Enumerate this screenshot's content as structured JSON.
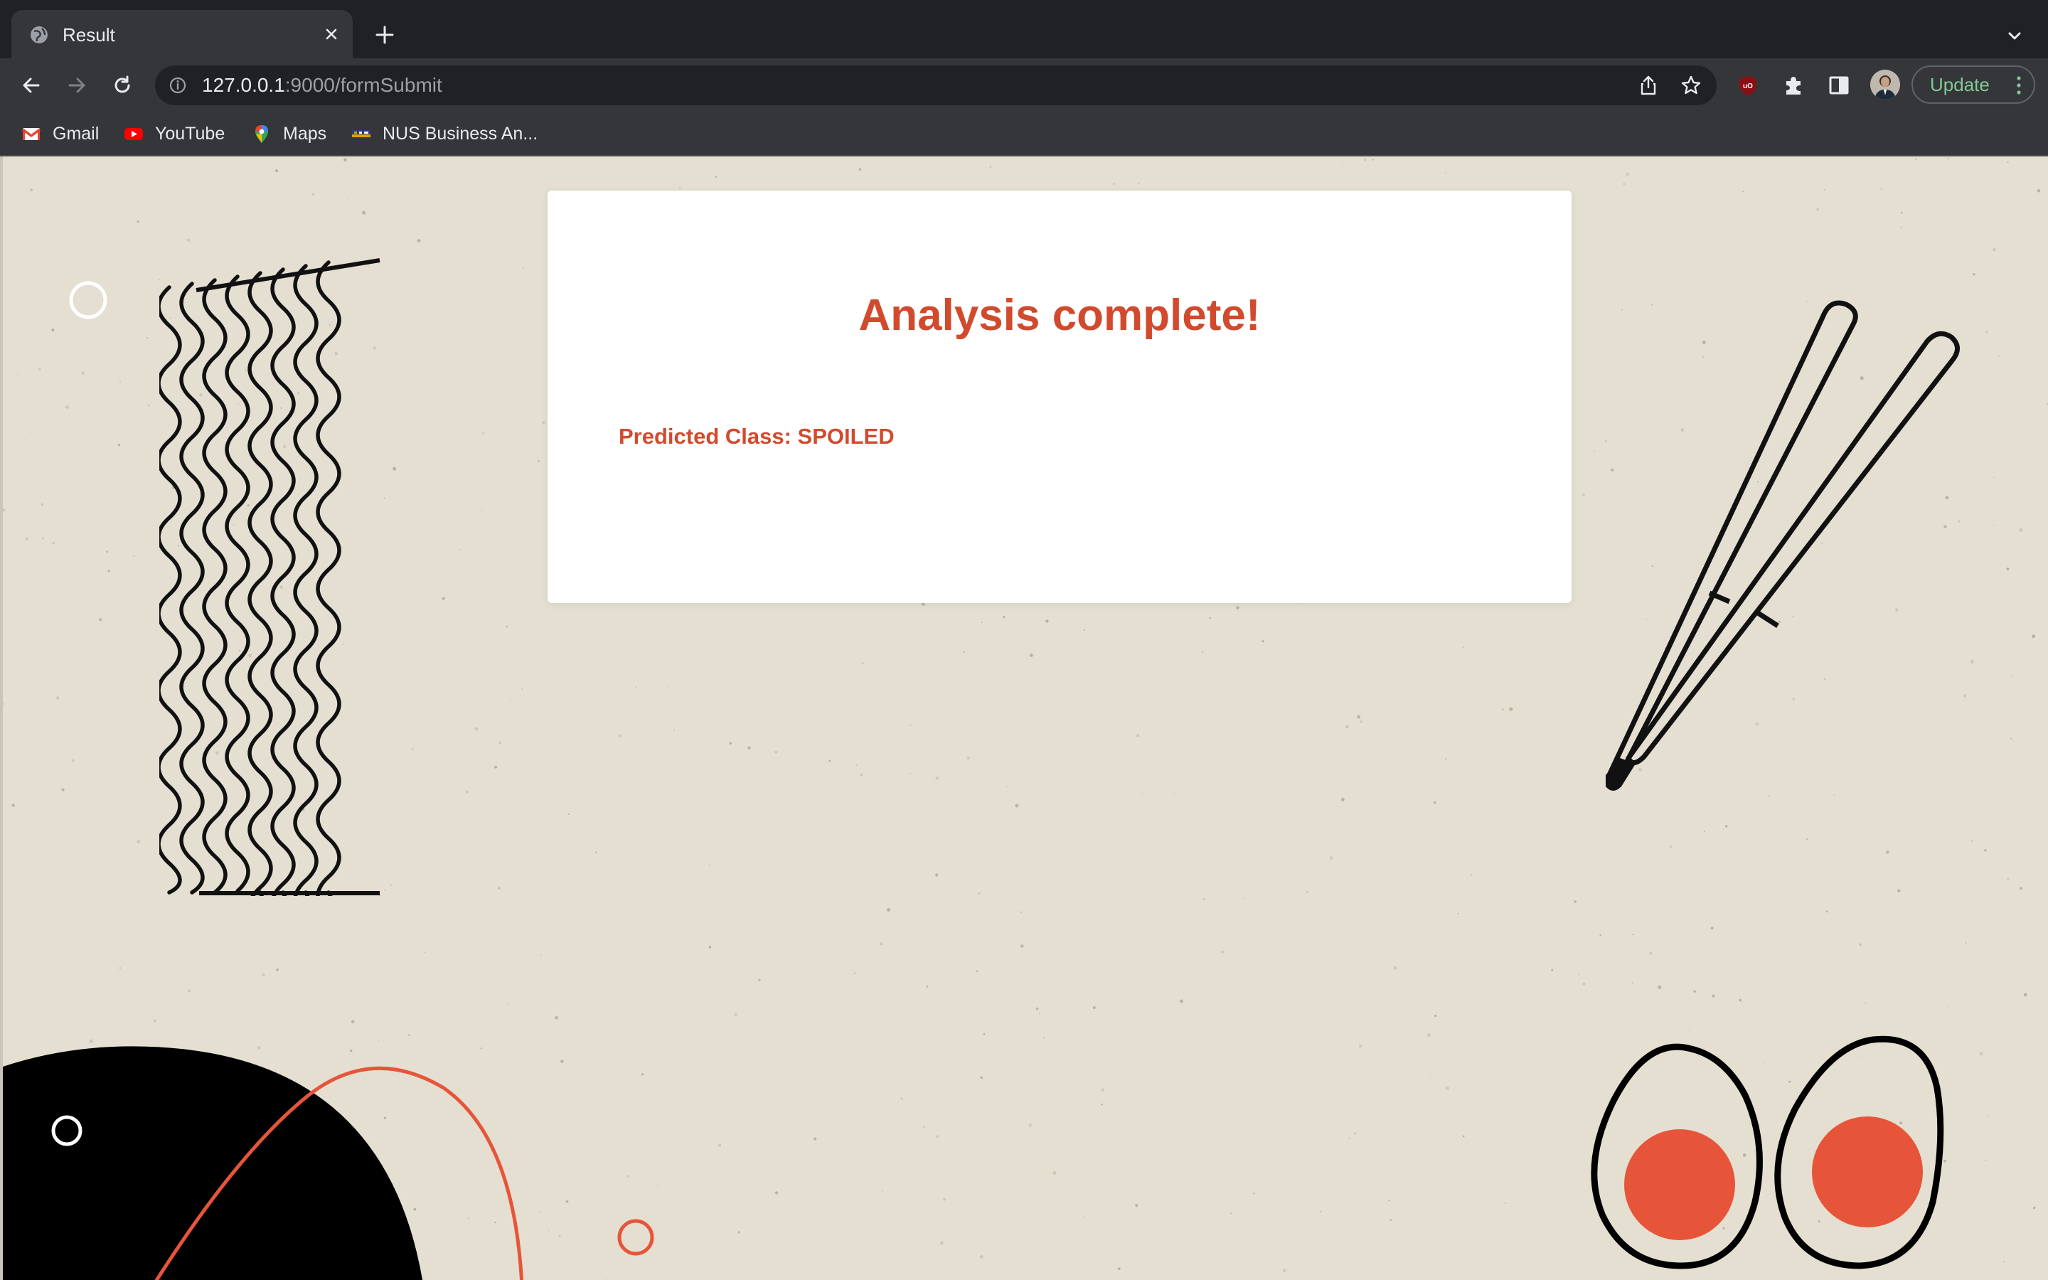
{
  "browser": {
    "tab": {
      "title": "Result",
      "close_icon": "close-icon"
    },
    "address_bar": {
      "url_host": "127.0.0.1",
      "url_rest": ":9000/formSubmit"
    },
    "update_label": "Update",
    "bookmarks": [
      {
        "label": "Gmail",
        "icon": "gmail-icon"
      },
      {
        "label": "YouTube",
        "icon": "youtube-icon"
      },
      {
        "label": "Maps",
        "icon": "maps-icon"
      },
      {
        "label": "NUS Business An...",
        "icon": "nus-icon"
      }
    ]
  },
  "page": {
    "heading": "Analysis complete!",
    "prediction": "Predicted Class: SPOILED"
  },
  "colors": {
    "accent": "#d24a2e",
    "page_background": "#e4dfd1",
    "card_background": "#ffffff",
    "egg_yolk": "#e6553a"
  }
}
